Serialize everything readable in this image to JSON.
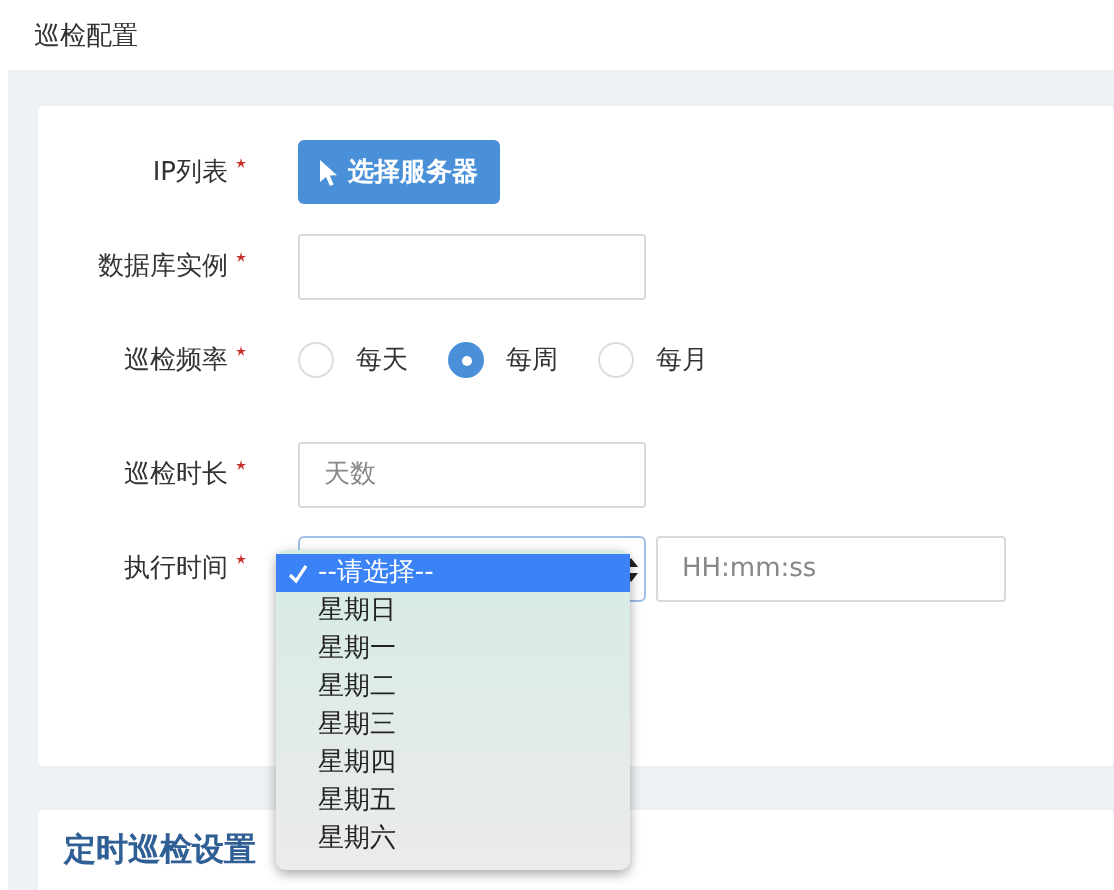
{
  "page_title": "巡检配置",
  "form": {
    "rows": [
      {
        "kind": "button",
        "label": "IP列表",
        "required": true,
        "button": "选择服务器"
      },
      {
        "kind": "input",
        "label": "数据库实例",
        "required": true
      },
      {
        "kind": "radio",
        "label": "巡检频率",
        "required": true,
        "options": [
          {
            "label": "每天",
            "selected": false
          },
          {
            "label": "每周",
            "selected": true
          },
          {
            "label": "每月",
            "selected": false
          }
        ]
      },
      {
        "kind": "input",
        "label": "巡检时长",
        "required": true,
        "placeholder": "天数"
      },
      {
        "kind": "select_time",
        "label": "执行时间",
        "required": true,
        "time_placeholder": "HH:mm:ss",
        "dropdown": {
          "expanded": true,
          "options": [
            {
              "label": "--请选择--",
              "selected": true
            },
            {
              "label": "星期日",
              "selected": false
            },
            {
              "label": "星期一",
              "selected": false
            },
            {
              "label": "星期二",
              "selected": false
            },
            {
              "label": "星期三",
              "selected": false
            },
            {
              "label": "星期四",
              "selected": false
            },
            {
              "label": "星期五",
              "selected": false
            },
            {
              "label": "星期六",
              "selected": false
            }
          ]
        }
      }
    ]
  },
  "section_title": "定时巡检设置"
}
